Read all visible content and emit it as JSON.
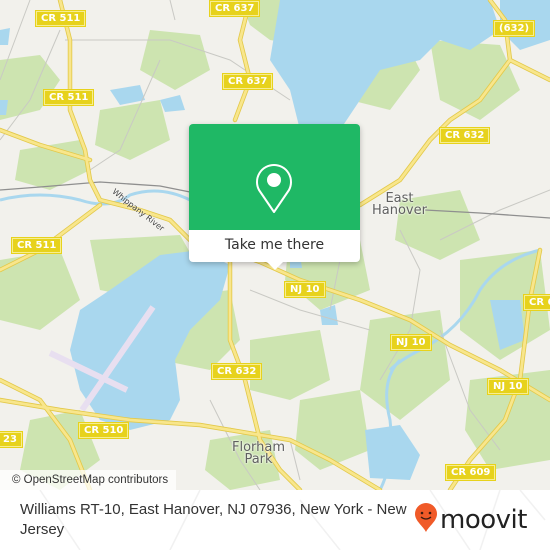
{
  "map": {
    "colors": {
      "land": "#f2f1ec",
      "water": "#a9d7ee",
      "park": "#cde4b0",
      "road": "#f6e27a",
      "road_outline": "#e3c94a",
      "runway": "#e8dff0",
      "rail": "#8f8f8f",
      "label_fill": "#e7d21c"
    },
    "road_labels": [
      {
        "text": "CR 637",
        "id": "cr637-top"
      },
      {
        "text": "CR 511",
        "id": "cr511-top"
      },
      {
        "text": "(632)",
        "id": "632-top-right"
      },
      {
        "text": "CR 637",
        "id": "cr637-mid"
      },
      {
        "text": "CR 511",
        "id": "cr511-mid"
      },
      {
        "text": "CR 632",
        "id": "cr632-east"
      },
      {
        "text": "CR 511",
        "id": "cr511-left"
      },
      {
        "text": "NJ 10",
        "id": "nj10-a"
      },
      {
        "text": "CR 6",
        "id": "cr6-edge"
      },
      {
        "text": "NJ 10",
        "id": "nj10-b"
      },
      {
        "text": "CR 632",
        "id": "cr632-south"
      },
      {
        "text": "NJ 10",
        "id": "nj10-c"
      },
      {
        "text": "CR 510",
        "id": "cr510"
      },
      {
        "text": "23",
        "id": "cr523-edge"
      },
      {
        "text": "CR 609",
        "id": "cr609"
      }
    ],
    "place_labels": [
      {
        "text": "East\nHanover",
        "id": "east-hanover"
      },
      {
        "text": "Florham\nPark",
        "id": "florham-park"
      }
    ],
    "river_label": "Whippany River",
    "attribution": "© OpenStreetMap contributors"
  },
  "popup": {
    "icon": "map-pin-icon",
    "button_label": "Take me there",
    "accent": "#1fb865"
  },
  "footer": {
    "address": "Williams RT-10, East Hanover, NJ 07936, New York - New Jersey",
    "logo_text": "moovit",
    "logo_color": "#f05a28"
  }
}
